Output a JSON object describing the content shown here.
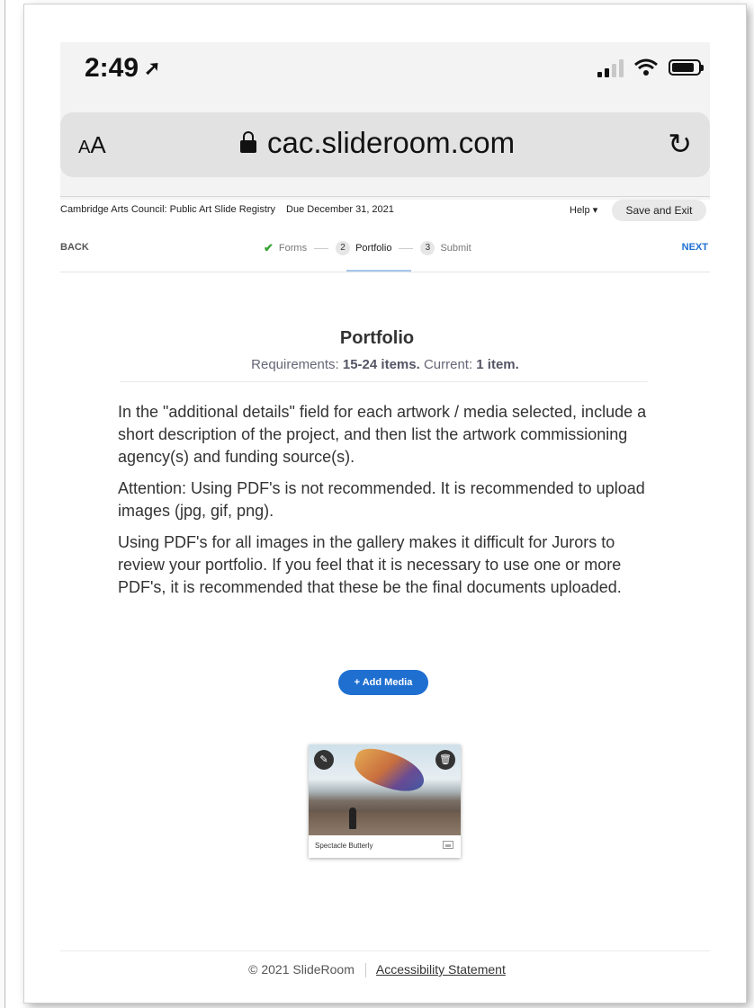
{
  "status_bar": {
    "time": "2:49"
  },
  "browser": {
    "text_size_small": "A",
    "text_size_large": "A",
    "url": "cac.slideroom.com"
  },
  "header": {
    "registry": "Cambridge Arts Council: Public Art Slide Registry",
    "due": "Due December 31, 2021",
    "help_label": "Help",
    "save_exit_label": "Save and Exit"
  },
  "nav": {
    "back_label": "BACK",
    "next_label": "NEXT",
    "steps": [
      {
        "label": "Forms",
        "state": "complete"
      },
      {
        "number": "2",
        "label": "Portfolio",
        "state": "active"
      },
      {
        "number": "3",
        "label": "Submit",
        "state": "upcoming"
      }
    ]
  },
  "portfolio": {
    "title": "Portfolio",
    "req_prefix": "Requirements:",
    "req_items": "15-24 items.",
    "current_prefix": "Current:",
    "current_items": "1 item.",
    "paragraphs": [
      "In the \"additional details\" field for each artwork / media selected, include a short description of the project, and then list the artwork commissioning agency(s) and funding source(s).",
      "Attention: Using PDF's is not recommended. It is recommended to upload images (jpg, gif, png).",
      "Using PDF's for all images in the gallery makes it difficult for Jurors to review your portfolio. If you feel that it is necessary to use one or more PDF's, it is recommended that these be the final documents uploaded."
    ],
    "add_media_label": "+ Add Media",
    "items": [
      {
        "caption": "Spectacle Butterly",
        "type_icon": "image-icon"
      }
    ]
  },
  "footer": {
    "copyright": "© 2021 SlideRoom",
    "accessibility_label": "Accessibility Statement"
  },
  "colors": {
    "accent": "#1f6fd1",
    "complete": "#3aa435"
  }
}
